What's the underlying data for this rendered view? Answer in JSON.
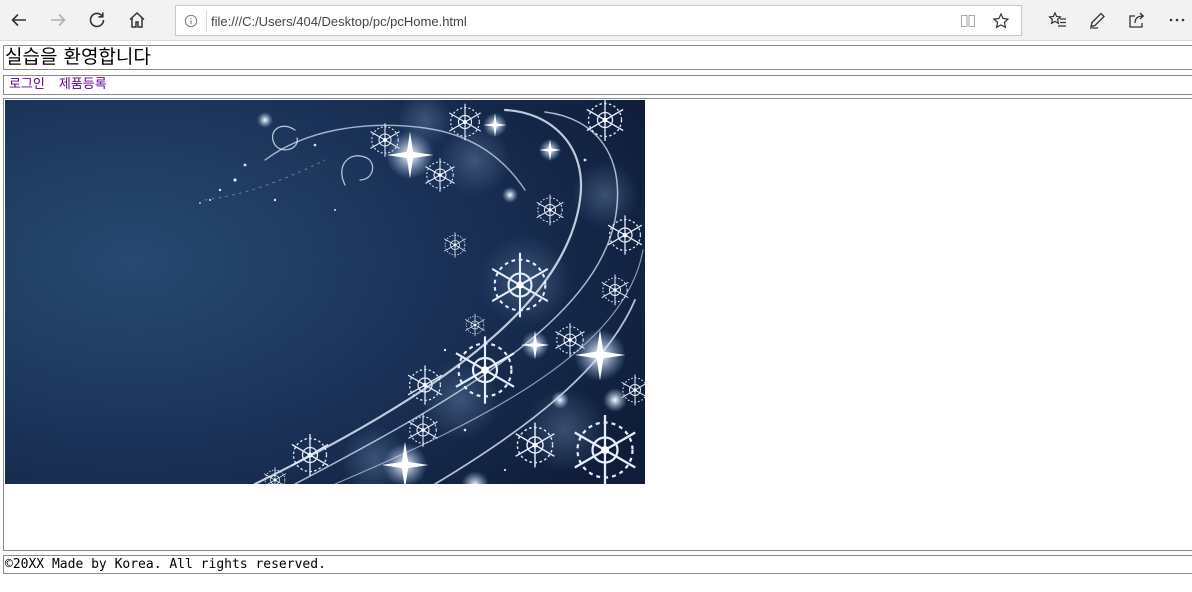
{
  "browser": {
    "address": "file:///C:/Users/404/Desktop/pc/pcHome.html",
    "icons": {
      "back": "arrow-left-icon",
      "forward": "arrow-right-icon",
      "refresh": "refresh-icon",
      "home": "home-icon",
      "info": "info-icon",
      "reading_view": "book-icon",
      "favorite": "star-icon",
      "favorites_list": "favorites-icon",
      "notes": "pen-icon",
      "share": "share-icon",
      "more": "ellipsis-icon"
    }
  },
  "page": {
    "title": "실습을 환영합니다",
    "menu": [
      {
        "label": "로그인"
      },
      {
        "label": "제품등록"
      }
    ],
    "banner": {
      "description": "christmas-snowflake-banner"
    },
    "footer": "©20XX Made by Korea. All rights reserved.",
    "colors": {
      "link_visited": "#660099",
      "banner_bg": "#16284a"
    }
  }
}
